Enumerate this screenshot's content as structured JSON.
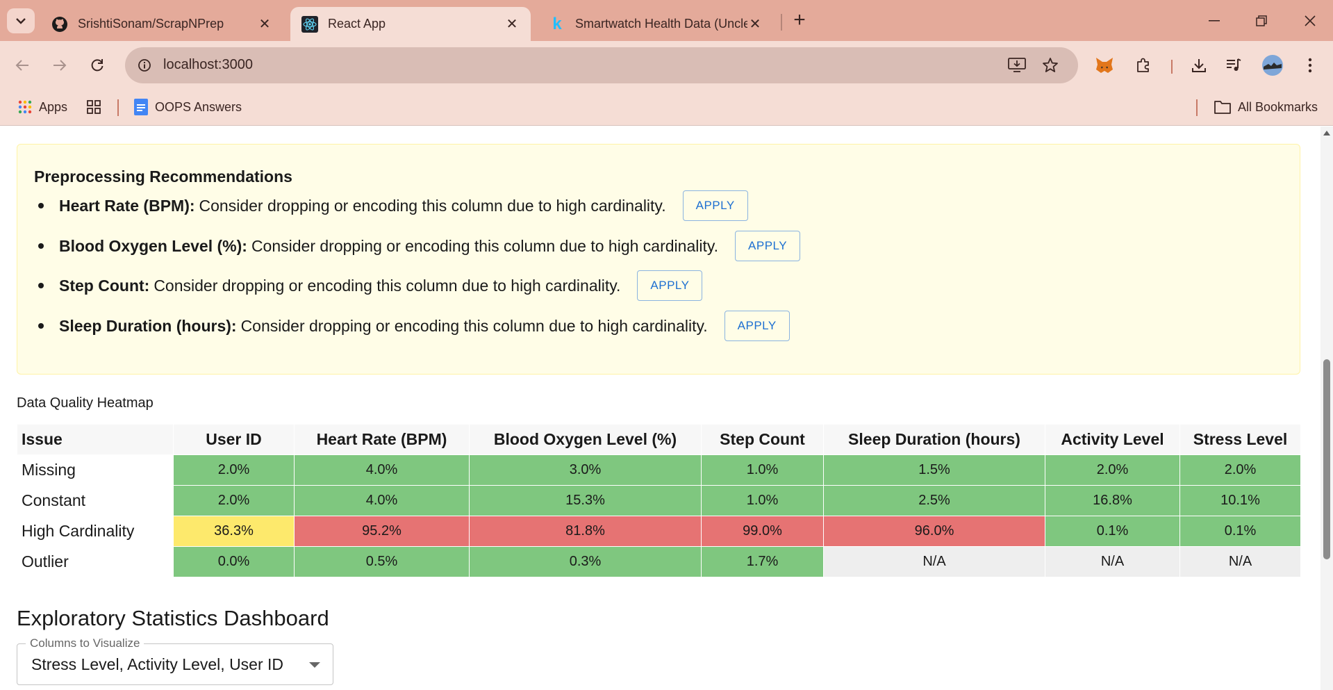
{
  "browser": {
    "tabs": [
      {
        "title": "SrishtiSonam/ScrapNPrep",
        "icon": "github-icon",
        "active": false
      },
      {
        "title": "React App",
        "icon": "react-icon",
        "active": true
      },
      {
        "title": "Smartwatch Health Data (Uncle",
        "icon": "kaggle-icon",
        "active": false
      }
    ],
    "url": "localhost:3000",
    "bookmarks": {
      "apps": "Apps",
      "oops": "OOPS Answers",
      "all": "All Bookmarks"
    }
  },
  "recommendations": {
    "title": "Preprocessing Recommendations",
    "apply_label": "APPLY",
    "items": [
      {
        "column": "Heart Rate (BPM):",
        "text": "Consider dropping or encoding this column due to high cardinality."
      },
      {
        "column": "Blood Oxygen Level (%):",
        "text": "Consider dropping or encoding this column due to high cardinality."
      },
      {
        "column": "Step Count:",
        "text": "Consider dropping or encoding this column due to high cardinality."
      },
      {
        "column": "Sleep Duration (hours):",
        "text": "Consider dropping or encoding this column due to high cardinality."
      }
    ]
  },
  "heatmap": {
    "title": "Data Quality Heatmap",
    "headers": [
      "Issue",
      "User ID",
      "Heart Rate (BPM)",
      "Blood Oxygen Level (%)",
      "Step Count",
      "Sleep Duration (hours)",
      "Activity Level",
      "Stress Level"
    ],
    "rows": [
      {
        "issue": "Missing",
        "cells": [
          [
            "2.0%",
            "green"
          ],
          [
            "4.0%",
            "green"
          ],
          [
            "3.0%",
            "green"
          ],
          [
            "1.0%",
            "green"
          ],
          [
            "1.5%",
            "green"
          ],
          [
            "2.0%",
            "green"
          ],
          [
            "2.0%",
            "green"
          ]
        ]
      },
      {
        "issue": "Constant",
        "cells": [
          [
            "2.0%",
            "green"
          ],
          [
            "4.0%",
            "green"
          ],
          [
            "15.3%",
            "green"
          ],
          [
            "1.0%",
            "green"
          ],
          [
            "2.5%",
            "green"
          ],
          [
            "16.8%",
            "green"
          ],
          [
            "10.1%",
            "green"
          ]
        ]
      },
      {
        "issue": "High Cardinality",
        "cells": [
          [
            "36.3%",
            "yellow"
          ],
          [
            "95.2%",
            "red"
          ],
          [
            "81.8%",
            "red"
          ],
          [
            "99.0%",
            "red"
          ],
          [
            "96.0%",
            "red"
          ],
          [
            "0.1%",
            "green"
          ],
          [
            "0.1%",
            "green"
          ]
        ]
      },
      {
        "issue": "Outlier",
        "cells": [
          [
            "0.0%",
            "green"
          ],
          [
            "0.5%",
            "green"
          ],
          [
            "0.3%",
            "green"
          ],
          [
            "1.7%",
            "green"
          ],
          [
            "N/A",
            "na"
          ],
          [
            "N/A",
            "na"
          ],
          [
            "N/A",
            "na"
          ]
        ]
      }
    ],
    "colors": {
      "green": "#7fc77f",
      "yellow": "#fde96c",
      "red": "#e67373",
      "na": "#eeeeee"
    }
  },
  "dashboard": {
    "title": "Exploratory Statistics Dashboard",
    "select_label": "Columns to Visualize",
    "select_value": "Stress Level, Activity Level, User ID"
  }
}
